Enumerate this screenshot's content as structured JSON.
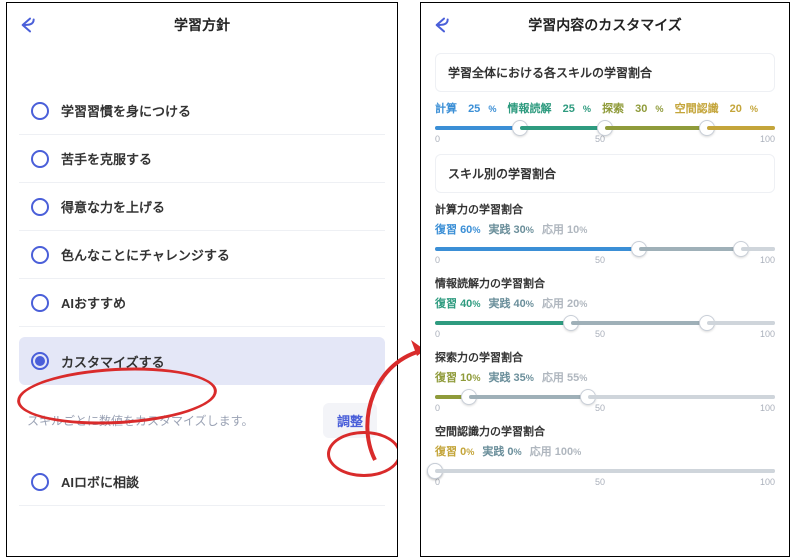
{
  "left": {
    "title": "学習方針",
    "options": [
      "学習習慣を身につける",
      "苦手を克服する",
      "得意な力を上げる",
      "色んなことにチャレンジする",
      "AIおすすめ"
    ],
    "selected_label": "カスタマイズする",
    "hint": "スキルごとに数値をカスタマイズします。",
    "adjust_label": "調整",
    "extra_option": "AIロボに相談"
  },
  "right": {
    "title": "学習内容のカスタマイズ",
    "overall_section": "学習全体における各スキルの学習割合",
    "overall": {
      "skills": [
        {
          "name": "計算",
          "pct": 25,
          "color": "#3b8fd6"
        },
        {
          "name": "情報読解",
          "pct": 25,
          "color": "#2e9b7f"
        },
        {
          "name": "探索",
          "pct": 30,
          "color": "#8f9b3a"
        },
        {
          "name": "空間認識",
          "pct": 20,
          "color": "#c4a53a"
        }
      ]
    },
    "per_skill_section": "スキル別の学習割合",
    "labels": {
      "review": "復習",
      "practice": "実践",
      "apply": "応用"
    },
    "skills": [
      {
        "title": "計算力の学習割合",
        "color": "#3b8fd6",
        "breakdown": [
          60,
          30,
          10
        ]
      },
      {
        "title": "情報読解力の学習割合",
        "color": "#2e9b7f",
        "breakdown": [
          40,
          40,
          20
        ]
      },
      {
        "title": "探索力の学習割合",
        "color": "#8f9b3a",
        "breakdown": [
          10,
          35,
          55
        ]
      },
      {
        "title": "空間認識力の学習割合",
        "color": "#c4a53a",
        "breakdown": [
          0,
          0,
          100
        ]
      }
    ],
    "scale": [
      "0",
      "50",
      "100"
    ]
  }
}
